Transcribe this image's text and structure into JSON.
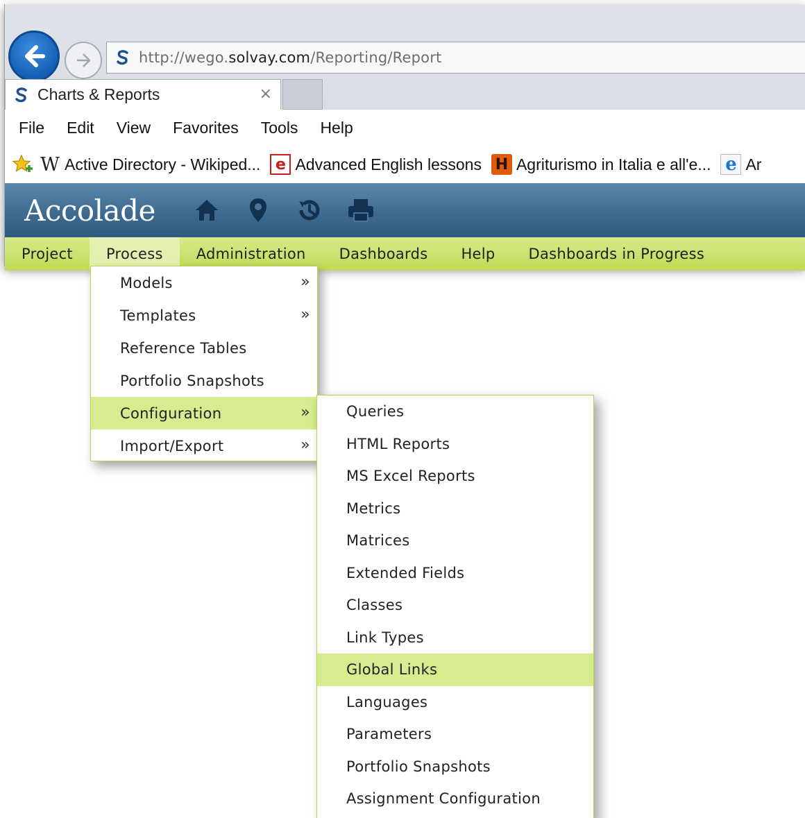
{
  "browser": {
    "url_prefix": "http://wego.",
    "url_domain": "solvay.com",
    "url_path": "/Reporting/Report",
    "tab_title": "Charts & Reports",
    "tab_close": "×",
    "menu": [
      "File",
      "Edit",
      "View",
      "Favorites",
      "Tools",
      "Help"
    ],
    "favorites": [
      {
        "icon": "wikipedia-icon",
        "label": "Active Directory - Wikiped..."
      },
      {
        "icon": "e-lessons-icon",
        "label": "Advanced English lessons"
      },
      {
        "icon": "h-agriturismo-icon",
        "label": "Agriturismo in Italia e all'e..."
      },
      {
        "icon": "ie-page-icon",
        "label": "Ar"
      }
    ]
  },
  "app": {
    "brand": "Accolade",
    "nav": [
      "Project",
      "Process",
      "Administration",
      "Dashboards",
      "Help",
      "Dashboards in Progress"
    ],
    "active_nav": "Process",
    "process_menu": [
      {
        "label": "Models",
        "arrow": "»"
      },
      {
        "label": "Templates",
        "arrow": "»"
      },
      {
        "label": "Reference Tables",
        "arrow": ""
      },
      {
        "label": "Portfolio Snapshots",
        "arrow": ""
      },
      {
        "label": "Configuration",
        "arrow": "»"
      },
      {
        "label": "Import/Export",
        "arrow": "»"
      }
    ],
    "configuration_menu": [
      "Queries",
      "HTML Reports",
      "MS Excel Reports",
      "Metrics",
      "Matrices",
      "Extended Fields",
      "Classes",
      "Link Types",
      "Global Links",
      "Languages",
      "Parameters",
      "Portfolio Snapshots",
      "Assignment Configuration"
    ],
    "highlighted_process_item": "Configuration",
    "highlighted_config_item": "Global Links",
    "colors": {
      "header_blue": "#3f6b91",
      "nav_green": "#c6e063",
      "highlight_green": "#d7eb8f",
      "back_button_blue": "#1a6bc4"
    }
  }
}
